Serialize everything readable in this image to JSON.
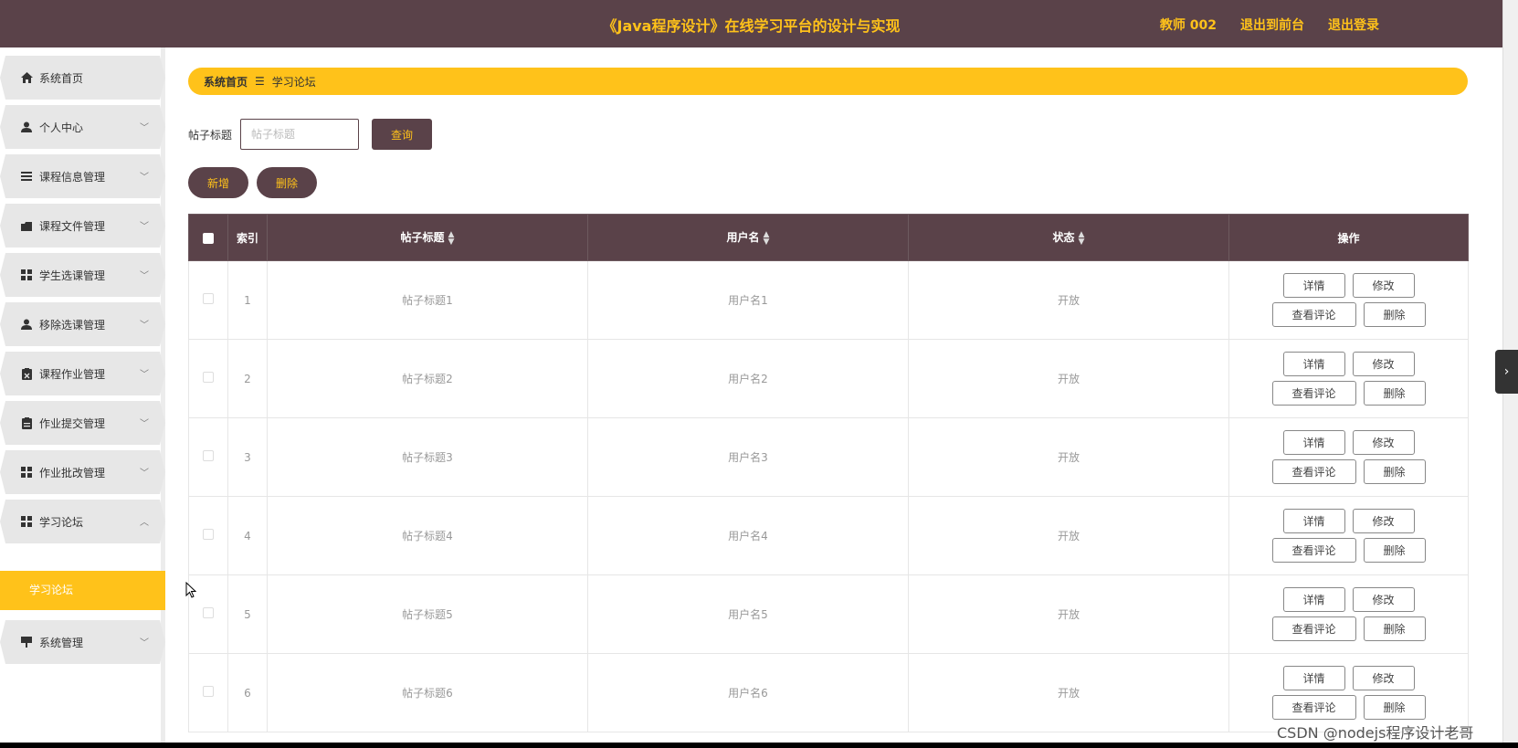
{
  "header": {
    "title": "《Java程序设计》在线学习平台的设计与实现",
    "nav": [
      "教师 002",
      "退出到前台",
      "退出登录"
    ]
  },
  "sidebar": {
    "items": [
      {
        "label": "系统首页",
        "icon": "home-icon",
        "chevron": false
      },
      {
        "label": "个人中心",
        "icon": "user-icon",
        "chevron": true
      },
      {
        "label": "课程信息管理",
        "icon": "list-icon",
        "chevron": true
      },
      {
        "label": "课程文件管理",
        "icon": "folder-icon",
        "chevron": true
      },
      {
        "label": "学生选课管理",
        "icon": "grid-icon",
        "chevron": true
      },
      {
        "label": "移除选课管理",
        "icon": "user-icon",
        "chevron": true
      },
      {
        "label": "课程作业管理",
        "icon": "clipboard-icon",
        "chevron": true
      },
      {
        "label": "作业提交管理",
        "icon": "clipboard-icon",
        "chevron": true
      },
      {
        "label": "作业批改管理",
        "icon": "grid-icon",
        "chevron": true
      },
      {
        "label": "学习论坛",
        "icon": "grid-icon",
        "chevron": true,
        "expanded": true
      },
      {
        "label": "系统管理",
        "icon": "sign-icon",
        "chevron": true
      }
    ],
    "active_sub": "学习论坛"
  },
  "breadcrumb": {
    "home": "系统首页",
    "sep": "☰",
    "current": "学习论坛"
  },
  "search": {
    "label": "帖子标题",
    "placeholder": "帖子标题",
    "button": "查询"
  },
  "actions": {
    "add": "新增",
    "delete": "删除"
  },
  "table": {
    "columns": [
      "索引",
      "帖子标题",
      "用户名",
      "状态",
      "操作"
    ],
    "rows": [
      {
        "index": "1",
        "title": "帖子标题1",
        "user": "用户名1",
        "status": "开放"
      },
      {
        "index": "2",
        "title": "帖子标题2",
        "user": "用户名2",
        "status": "开放"
      },
      {
        "index": "3",
        "title": "帖子标题3",
        "user": "用户名3",
        "status": "开放"
      },
      {
        "index": "4",
        "title": "帖子标题4",
        "user": "用户名4",
        "status": "开放"
      },
      {
        "index": "5",
        "title": "帖子标题5",
        "user": "用户名5",
        "status": "开放"
      },
      {
        "index": "6",
        "title": "帖子标题6",
        "user": "用户名6",
        "status": "开放"
      }
    ],
    "row_ops": {
      "detail": "详情",
      "edit": "修改",
      "comments": "查看评论",
      "delete": "删除"
    }
  },
  "watermark": "CSDN @nodejs程序设计老哥",
  "colors": {
    "header": "#5a4249",
    "accent": "#ffc21a"
  }
}
